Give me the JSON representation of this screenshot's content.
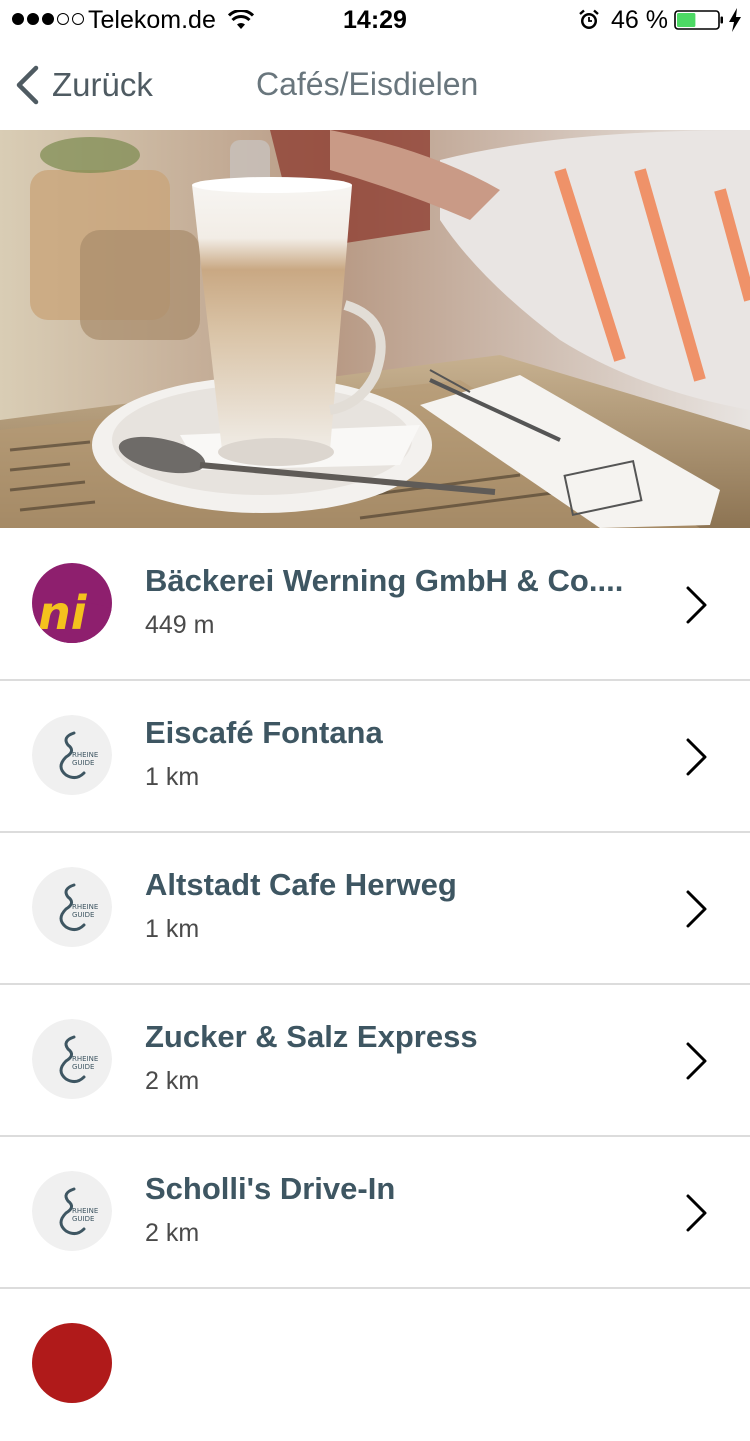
{
  "status_bar": {
    "carrier": "Telekom.de",
    "time": "14:29",
    "battery_percent": "46 %",
    "battery_level": 0.46,
    "signal_bars_filled": 3,
    "signal_bars_total": 5,
    "icons": [
      "wifi-icon",
      "alarm-icon",
      "battery-icon",
      "charging-bolt-icon"
    ]
  },
  "nav": {
    "back_label": "Zurück",
    "title": "Cafés/Eisdielen",
    "back_icon": "chevron-left-icon"
  },
  "hero": {
    "image": "latte-macchiato-photo"
  },
  "list": {
    "items": [
      {
        "name": "Bäckerei Werning GmbH & Co....",
        "distance": "449 m",
        "avatar": "werning-logo"
      },
      {
        "name": "Eiscafé Fontana",
        "distance": "1 km",
        "avatar": "rheine-guide-logo"
      },
      {
        "name": "Altstadt Cafe Herweg",
        "distance": "1 km",
        "avatar": "rheine-guide-logo"
      },
      {
        "name": "Zucker & Salz Express",
        "distance": "2 km",
        "avatar": "rheine-guide-logo"
      },
      {
        "name": "Scholli's Drive-In",
        "distance": "2 km",
        "avatar": "rheine-guide-logo"
      }
    ]
  },
  "colors": {
    "item_title": "#3e5662",
    "divider": "#dcdcdc",
    "battery_fill": "#4cd964",
    "werning_brand": "#8e1f6e"
  },
  "logo_text": {
    "rheine_guide_line1": "RHEINE",
    "rheine_guide_line2": "GUIDE",
    "werning": "ni"
  }
}
